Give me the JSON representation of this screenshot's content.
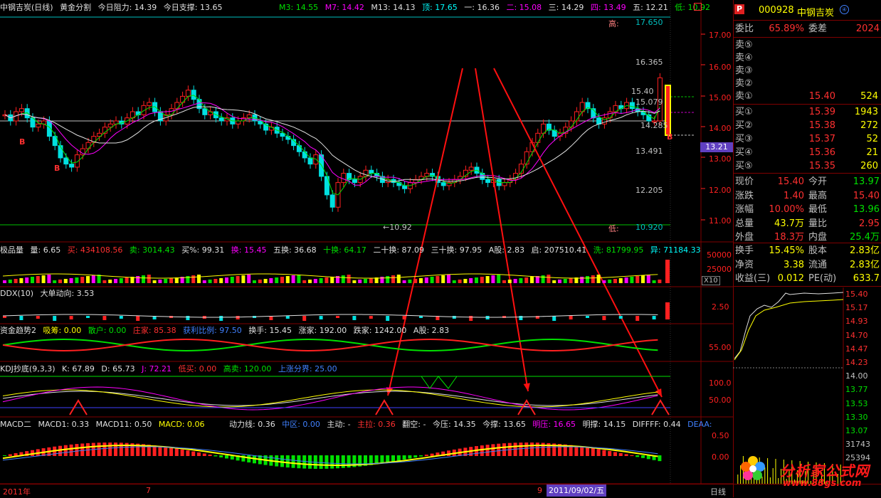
{
  "title_bar": {
    "name": "中钢吉炭(日线)",
    "indicator": "黄金分割",
    "resist": "今日阻力: 14.39",
    "support": "今日支撑: 13.65",
    "m3": "M3: 14.55",
    "m7": "M7: 14.42",
    "m13": "M13: 14.13",
    "top": "顶: 17.65",
    "one": "一: 16.36",
    "two": "二: 15.08",
    "three": "三: 14.29",
    "four": "四: 13.49",
    "five": "五: 12.21",
    "low": "低: 10.92"
  },
  "main_chart": {
    "labels": {
      "high": "高:",
      "high_val": "17.650",
      "l16": "16.365",
      "l15": "15.40",
      "l15b": "15.079",
      "l14": "14.285",
      "l13": "13.491",
      "l12": "12.205",
      "low": "低:",
      "low_val": "10.920",
      "min_mark": "←10.92",
      "b1": "B",
      "b2": "B",
      "b3": "B"
    },
    "right_axis": [
      "17.00",
      "16.00",
      "15.00",
      "14.00",
      "13.00",
      "12.00",
      "11.00"
    ],
    "price_tag": "13.21"
  },
  "vol_panel": {
    "name": "极品量",
    "q": "量: 6.65",
    "buy": "买: 434108.56",
    "sell": "卖: 3014.43",
    "buypct": "买%: 99.31",
    "huan": "换: 15.45",
    "wu": "五换: 36.68",
    "shi": "十换: 64.17",
    "ershi": "二十换: 87.09",
    "sanshi": "三十换: 97.95",
    "agu": "A股: 2.83",
    "qi": "启: 207510.41",
    "xi": "洗: 81799.95",
    "yi": "异: 71184.33",
    "axis": [
      "50000",
      "25000"
    ],
    "unit": "X10"
  },
  "ddx_panel": {
    "name": "DDX(10)",
    "dir": "大单动向: 3.53",
    "axis": [
      "2.50"
    ]
  },
  "fund_panel": {
    "name": "资金趋势2",
    "xichou": "吸筹: 0.00",
    "sanhu": "散户: 0.00",
    "zhuangjia": "庄家: 85.38",
    "huoli": "获利比例: 97.50",
    "huanshou": "换手: 15.45",
    "zhangjia": "涨家: 192.00",
    "diejia": "跌家: 1242.00",
    "agu": "A股: 2.83",
    "axis": [
      "55.00"
    ]
  },
  "kdj_panel": {
    "name": "KDJ抄底(9,3,3)",
    "k": "K: 67.89",
    "d": "D: 65.73",
    "j": "J: 72.21",
    "dimai": "低买: 0.00",
    "gaomai": "高卖: 120.00",
    "shang": "上涨分界: 25.00",
    "axis": [
      "100.0",
      "50.00"
    ]
  },
  "macd_panel": {
    "name": "MACD二",
    "macd1": "MACD1: 0.33",
    "macd11": "MACD11: 0.50",
    "macd": "MACD: 0.06",
    "dongli": "动力线: 0.36",
    "zhongqu": "中区: 0.00",
    "zhudong": "主动: -",
    "zhula": "主拉: 0.36",
    "fankong": "翻空: -",
    "jinya": "今压: 14.35",
    "jincheng": "今撑: 13.65",
    "mingya": "明压: 16.65",
    "mingcheng": "明撑: 14.15",
    "difff": "DIFFFF: 0.44",
    "deaa": "DEAA:",
    "axis": [
      "0.50",
      "0.00"
    ]
  },
  "timeline": {
    "y2011": "2011年",
    "m7": "7",
    "m9": "9",
    "date": "2011/09/02/五",
    "right": "日线"
  },
  "side": {
    "code": "000928",
    "name": "中钢吉炭",
    "weibi_k": "委比",
    "weibi_v": "65.89%",
    "weicha_k": "委差",
    "weicha_v": "2024",
    "asks": [
      {
        "k": "卖⑤",
        "p": "",
        "v": ""
      },
      {
        "k": "卖④",
        "p": "",
        "v": ""
      },
      {
        "k": "卖③",
        "p": "",
        "v": ""
      },
      {
        "k": "卖②",
        "p": "",
        "v": ""
      },
      {
        "k": "卖①",
        "p": "15.40",
        "v": "524"
      }
    ],
    "bids": [
      {
        "k": "买①",
        "p": "15.39",
        "v": "1943"
      },
      {
        "k": "买②",
        "p": "15.38",
        "v": "272"
      },
      {
        "k": "买③",
        "p": "15.37",
        "v": "52"
      },
      {
        "k": "买④",
        "p": "15.36",
        "v": "21"
      },
      {
        "k": "买⑤",
        "p": "15.35",
        "v": "260"
      }
    ],
    "stats": [
      {
        "k1": "现价",
        "v1": "15.40",
        "k2": "今开",
        "v2": "13.97"
      },
      {
        "k1": "涨跌",
        "v1": "1.40",
        "k2": "最高",
        "v2": "15.40"
      },
      {
        "k1": "涨幅",
        "v1": "10.00%",
        "k2": "最低",
        "v2": "13.96"
      },
      {
        "k1": "总量",
        "v1": "43.7万",
        "k2": "量比",
        "v2": "2.95"
      },
      {
        "k1": "外盘",
        "v1": "18.3万",
        "k2": "内盘",
        "v2": "25.4万"
      }
    ],
    "stats2": [
      {
        "k1": "换手",
        "v1": "15.45%",
        "k2": "股本",
        "v2": "2.83亿"
      },
      {
        "k1": "净资",
        "v1": "3.38",
        "k2": "流通",
        "v2": "2.83亿"
      },
      {
        "k1": "收益(三)",
        "v1": "0.012",
        "k2": "PE(动)",
        "v2": "633.7"
      }
    ],
    "intraday_axis": [
      "15.40",
      "15.17",
      "14.93",
      "14.70",
      "14.47",
      "14.23",
      "14.00",
      "13.77",
      "13.53",
      "13.30",
      "13.07",
      "31743",
      "25394"
    ]
  },
  "watermark": {
    "cn": "分析家公式网",
    "url": "www.88gs.com"
  }
}
